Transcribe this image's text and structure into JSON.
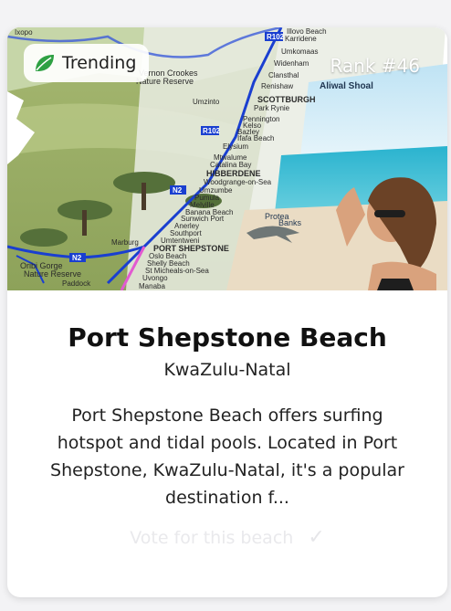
{
  "badge": {
    "label": "Trending"
  },
  "rank": {
    "label": "Rank #46"
  },
  "beach": {
    "name": "Port Shepstone Beach",
    "region": "KwaZulu-Natal",
    "description": "Port Shepstone Beach offers surfing hotspot and tidal pools. Located in Port Shepstone, KwaZulu-Natal, it's a popular destination f..."
  },
  "vote": {
    "label": "Vote for this beach"
  },
  "map_labels": {
    "ixopo": "Ixopo",
    "crookes": "Vernon Crookes",
    "nature_reserve": "Nature Reserve",
    "umzinto": "Umzinto",
    "scottburgh": "SCOTTBURGH",
    "park_rynie": "Park Rynie",
    "pennington": "Pennington",
    "kelso": "Kelso",
    "bazley": "Bazley",
    "ifafa": "Ifafa Beach",
    "elysium": "Elysium",
    "mtwalume": "Mtwalume",
    "catalina": "Catalina Bay",
    "hibberdene": "HIBBERDENE",
    "woodgrange": "Woodgrange-on-Sea",
    "umzumbe": "Umzumbe",
    "pumula": "Pumula",
    "melville": "Melville",
    "banana": "Banana Beach",
    "sunwich": "Sunwich Port",
    "anerley": "Anerley",
    "southport": "Southport",
    "umtentweni": "Umtentweni",
    "port_shepstone": "PORT SHEPSTONE",
    "oslo": "Oslo Beach",
    "shelly": "Shelly Beach",
    "st_micheals": "St Micheals-on-Sea",
    "uvongo": "Uvongo",
    "manaba": "Manaba",
    "illovo": "Illovo Beach",
    "karridene": "Karridene",
    "umkomaas": "Umkomaas",
    "widenham": "Widenham",
    "clansthal": "Clansthal",
    "renishaw": "Renishaw",
    "aliwal": "Aliwal Shoal",
    "protea": "Protea",
    "banks": "Banks",
    "marburg": "Marburg",
    "oribi": "Oribi Gorge",
    "oribi_nr": "Nature Reserve",
    "paddock": "Paddock",
    "r102_top": "R102",
    "r102_mid": "R102",
    "n2_a": "N2",
    "n2_b": "N2"
  }
}
